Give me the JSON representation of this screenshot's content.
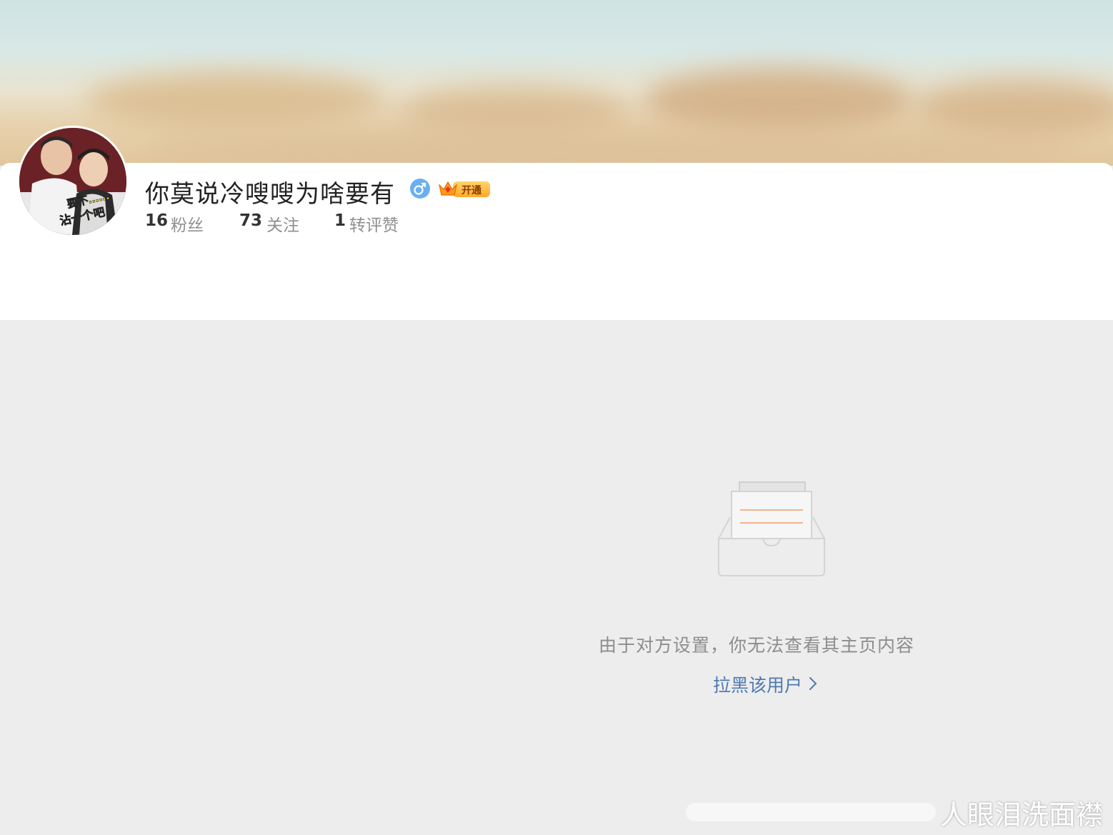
{
  "profile": {
    "username": "你莫说冷嗖嗖为啥要有",
    "vip_label": "开通",
    "gender_icon": "male-icon",
    "stats": [
      {
        "value": "16",
        "label": "粉丝"
      },
      {
        "value": "73",
        "label": "关注"
      },
      {
        "value": "1",
        "label": "转评赞"
      }
    ]
  },
  "empty_state": {
    "message": "由于对方设置，你无法查看其主页内容",
    "link_label": "拉黑该用户",
    "link_icon": "chevron-right-icon"
  },
  "watermark": {
    "text": "人眼泪洗面襟"
  },
  "colors": {
    "background": "#ededed",
    "card": "#ffffff",
    "link": "#4d7ab0",
    "gender": "#6ab0f0",
    "vip": "#ffa928"
  }
}
